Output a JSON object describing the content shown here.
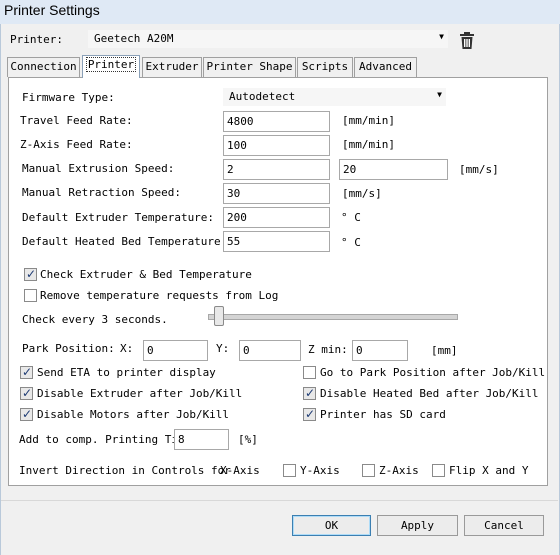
{
  "window": {
    "title": "Printer Settings"
  },
  "printer": {
    "label": "Printer:",
    "value": "Geetech A20M"
  },
  "tabs": [
    "Connection",
    "Printer",
    "Extruder",
    "Printer Shape",
    "Scripts",
    "Advanced"
  ],
  "form": {
    "firmware_label": "Firmware Type:",
    "firmware_value": "Autodetect",
    "travel_label": "Travel Feed Rate:",
    "travel_value": "4800",
    "travel_unit": "[mm/min]",
    "z_label": "Z-Axis Feed Rate:",
    "z_value": "100",
    "z_unit": "[mm/min]",
    "ext_label": "Manual Extrusion Speed:",
    "ext_value1": "2",
    "ext_value2": "20",
    "ext_unit": "[mm/s]",
    "ret_label": "Manual Retraction Speed:",
    "ret_value": "30",
    "ret_unit": "[mm/s]",
    "ext_temp_label": "Default Extruder Temperature:",
    "ext_temp_value": "200",
    "ext_temp_unit": "° C",
    "bed_temp_label": "Default Heated Bed Temperature:",
    "bed_temp_value": "55",
    "bed_temp_unit": "° C",
    "check_temp_label": "Check Extruder & Bed Temperature",
    "remove_temp_label": "Remove temperature requests from Log",
    "check_every_label": "Check every 3 seconds.",
    "check_every_slider_seconds": 3,
    "park_label": "Park Position:",
    "park_x_label": "X:",
    "park_x_value": "0",
    "park_y_label": "Y:",
    "park_y_value": "0",
    "park_z_label": "Z min:",
    "park_z_value": "0",
    "park_unit": "[mm]",
    "send_eta_label": "Send ETA to printer display",
    "go_park_label": "Go to Park Position after Job/Kill",
    "disable_extruder_label": "Disable Extruder after Job/Kill",
    "disable_bed_label": "Disable Heated Bed after Job/Kill",
    "disable_motors_label": "Disable Motors after Job/Kill",
    "sd_card_label": "Printer has SD card",
    "add_time_label": "Add to comp. Printing Time",
    "add_time_value": "8",
    "add_time_unit": "[%]",
    "invert_label": "Invert Direction in Controls for",
    "invert_x_label": "X-Axis",
    "invert_y_label": "Y-Axis",
    "invert_z_label": "Z-Axis",
    "flip_label": "Flip X and Y"
  },
  "checks": {
    "check_temp": true,
    "remove_temp": false,
    "send_eta": true,
    "go_park": false,
    "disable_extruder": true,
    "disable_bed": true,
    "disable_motors": true,
    "sd_card": true,
    "invert_y": false,
    "invert_z": false,
    "flip": false
  },
  "buttons": {
    "ok": "OK",
    "apply": "Apply",
    "cancel": "Cancel"
  },
  "icons": {
    "delete": "trash-icon",
    "dropdown": "chevron-down-icon",
    "check": "checkmark-icon"
  }
}
